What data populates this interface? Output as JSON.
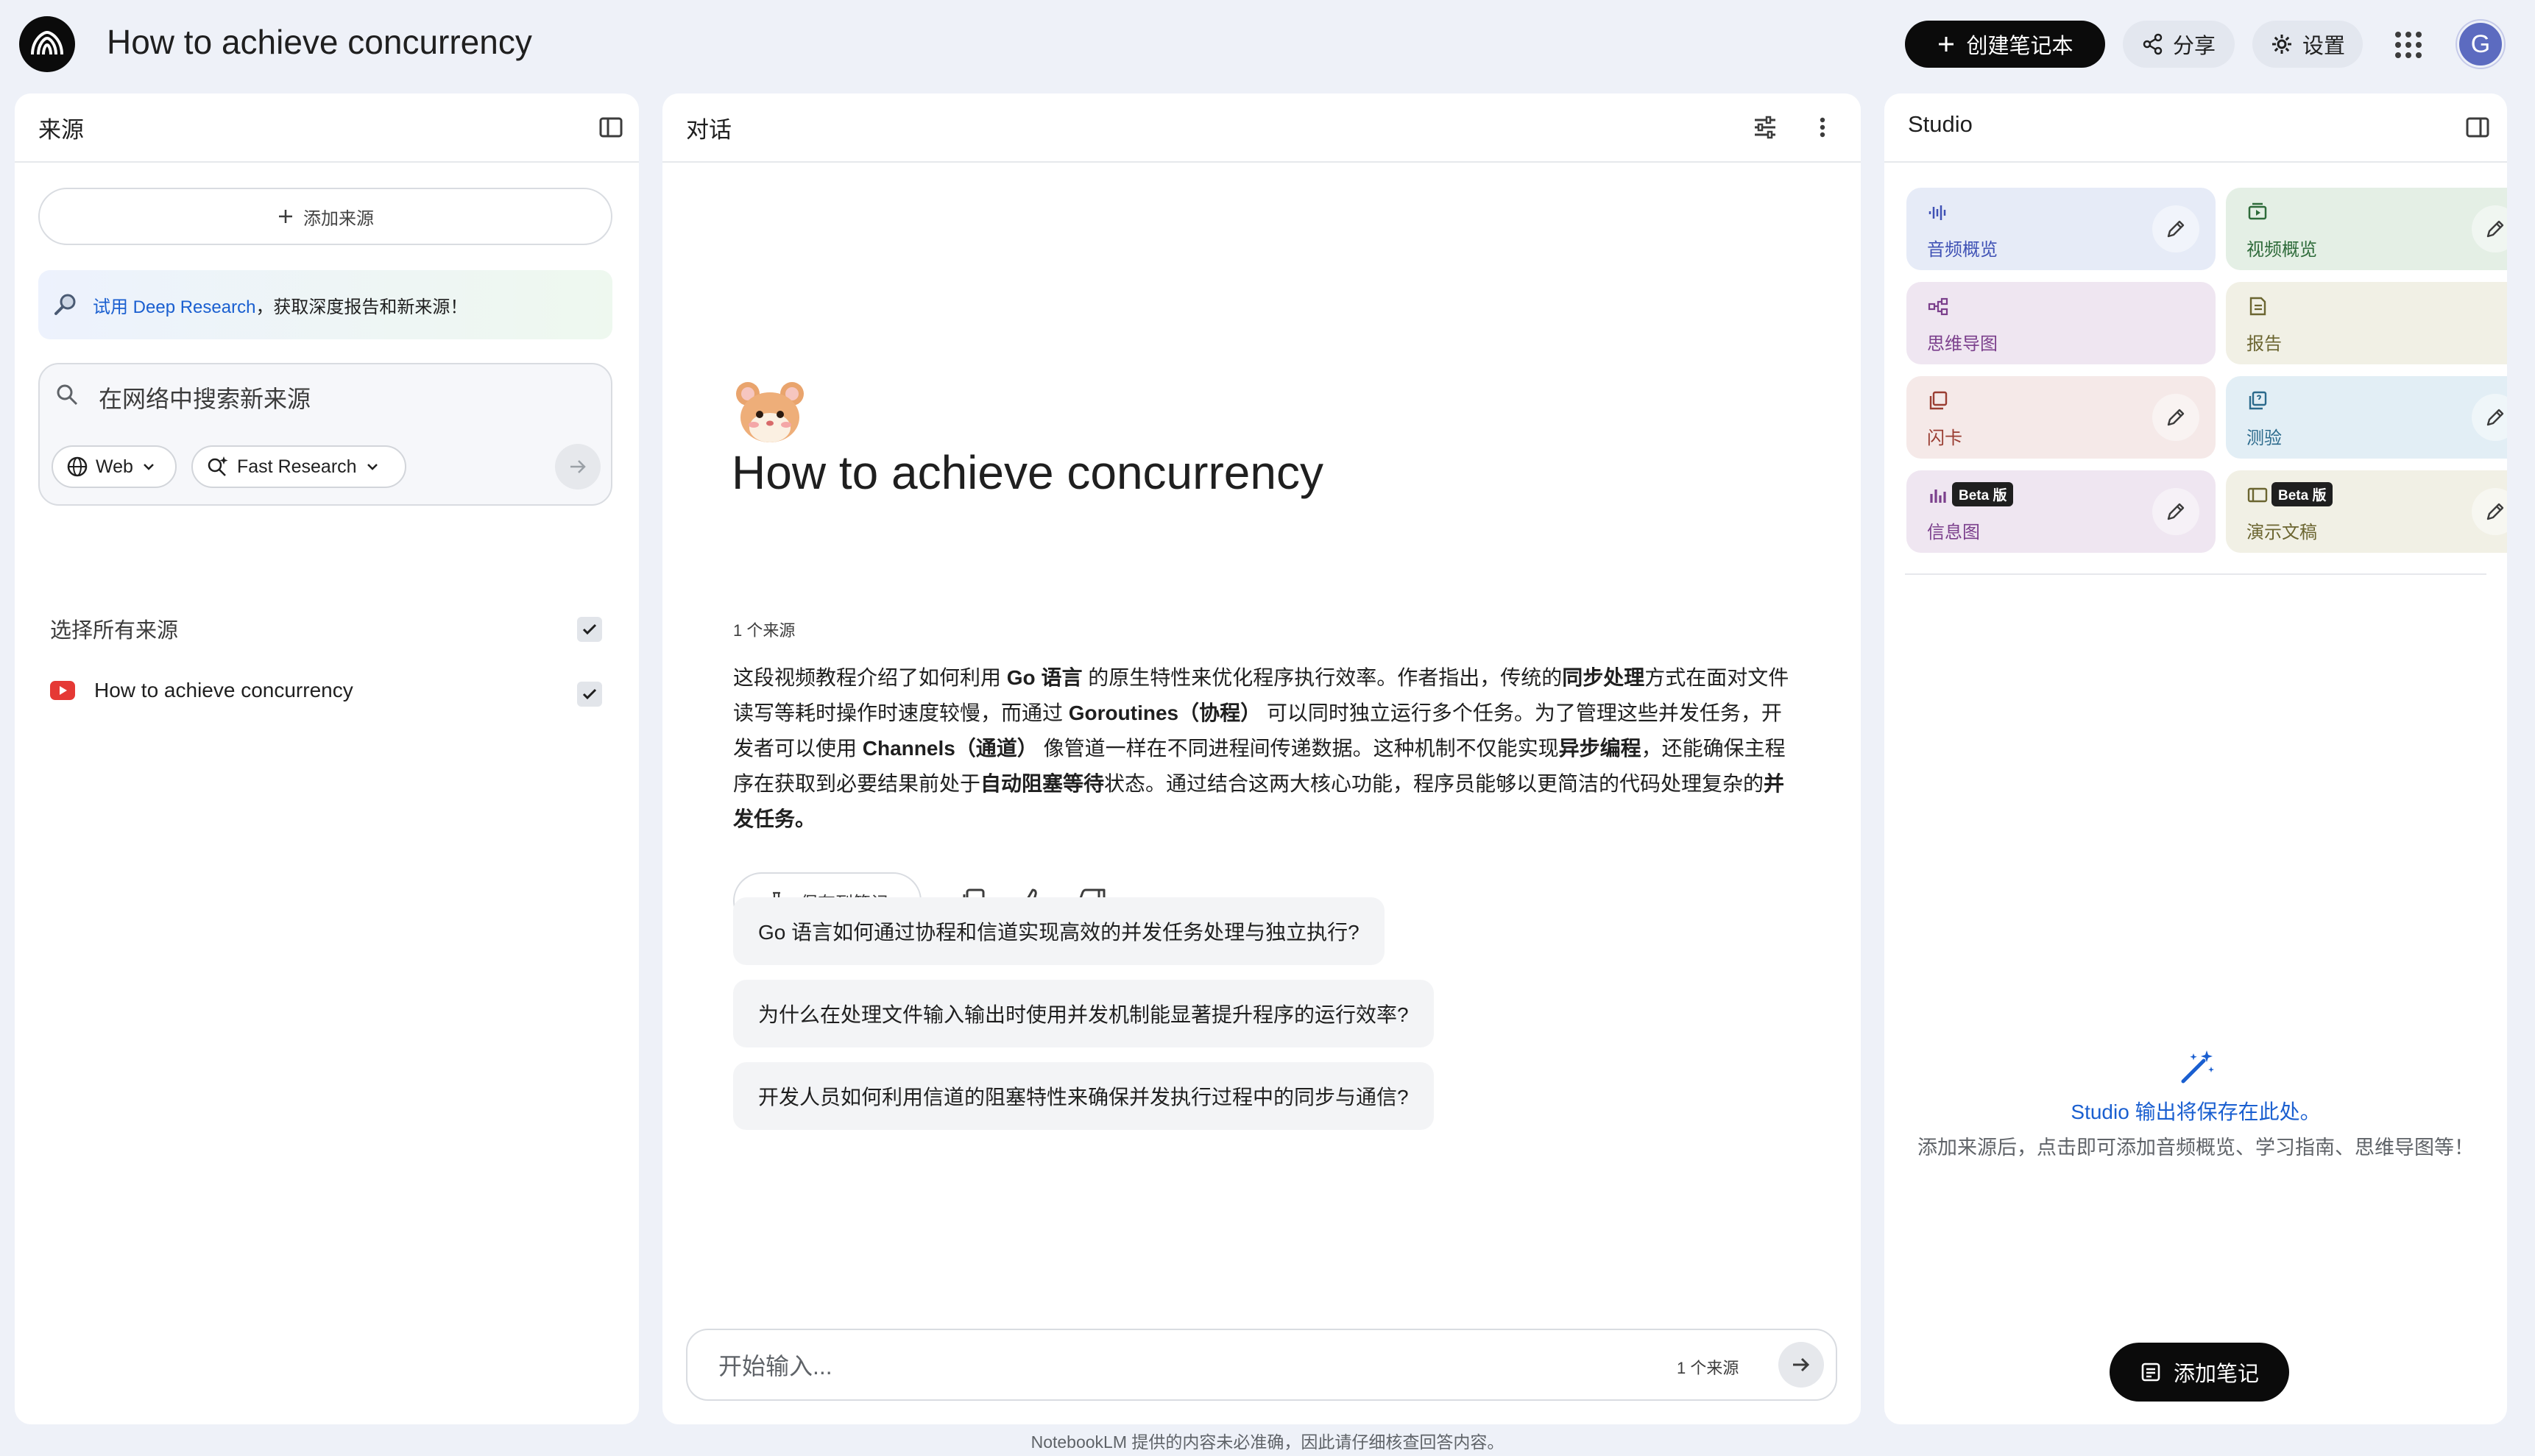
{
  "app": {
    "title": "How to achieve concurrency"
  },
  "topbar": {
    "create_label": "创建笔记本",
    "share_label": "分享",
    "settings_label": "设置",
    "avatar_initial": "G"
  },
  "sources": {
    "title": "来源",
    "add_label": "添加来源",
    "deep_research": {
      "link": "试用 Deep Research",
      "text": "，获取深度报告和新来源！"
    },
    "search_placeholder": "在网络中搜索新来源",
    "web_chip": "Web",
    "research_chip": "Fast Research",
    "select_all": "选择所有来源",
    "items": [
      {
        "label": "How to achieve concurrency",
        "checked": true
      }
    ]
  },
  "chat": {
    "title": "对话",
    "emoji": "🐹",
    "heading": "How to achieve concurrency",
    "source_count": "1 个来源",
    "summary": [
      {
        "text": "这段视频教程介绍了如何利用 ",
        "b": false
      },
      {
        "text": "Go 语言",
        "b": true
      },
      {
        "text": " 的原生特性来优化程序执行效率。作者指出，传统的",
        "b": false
      },
      {
        "text": "同步处理",
        "b": true
      },
      {
        "text": "方式在面对文件读写等耗时操作时速度较慢，而通过 ",
        "b": false
      },
      {
        "text": "Goroutines（协程）",
        "b": true
      },
      {
        "text": " 可以同时独立运行多个任务。为了管理这些并发任务，开发者可以使用 ",
        "b": false
      },
      {
        "text": "Channels（通道）",
        "b": true
      },
      {
        "text": " 像管道一样在不同进程间传递数据。这种机制不仅能实现",
        "b": false
      },
      {
        "text": "异步编程",
        "b": true
      },
      {
        "text": "，还能确保主程序在获取到必要结果前处于",
        "b": false
      },
      {
        "text": "自动阻塞等待",
        "b": true
      },
      {
        "text": "状态。通过结合这两大核心功能，程序员能够以更简洁的代码处理复杂的",
        "b": false
      },
      {
        "text": "并发任务。",
        "b": true
      }
    ],
    "save_note_label": "保存到笔记",
    "suggestions": [
      "Go 语言如何通过协程和信道实现高效的并发任务处理与独立执行?",
      "为什么在处理文件输入输出时使用并发机制能显著提升程序的运行效率?",
      "开发人员如何利用信道的阻塞特性来确保并发执行过程中的同步与通信?"
    ],
    "input_placeholder": "开始输入...",
    "input_source_count": "1 个来源"
  },
  "studio": {
    "title": "Studio",
    "tiles": [
      {
        "label": "音频概览",
        "icon": "audio-overview-icon",
        "bg": "#e6ebf7",
        "fg": "#3f51b5",
        "beta": false,
        "edit": true
      },
      {
        "label": "视频概览",
        "icon": "video-overview-icon",
        "bg": "#e4efe5",
        "fg": "#2e6b3a",
        "beta": false,
        "edit": true
      },
      {
        "label": "思维导图",
        "icon": "mind-map-icon",
        "bg": "#efe6f1",
        "fg": "#7b3f8c",
        "beta": false,
        "edit": false
      },
      {
        "label": "报告",
        "icon": "report-icon",
        "bg": "#f1f0e5",
        "fg": "#6b6530",
        "beta": false,
        "edit": false
      },
      {
        "label": "闪卡",
        "icon": "flashcards-icon",
        "bg": "#f5e9e8",
        "fg": "#9a3d32",
        "beta": false,
        "edit": true
      },
      {
        "label": "测验",
        "icon": "quiz-icon",
        "bg": "#e2eef5",
        "fg": "#2b6a8c",
        "beta": false,
        "edit": true
      },
      {
        "label": "信息图",
        "icon": "infographic-icon",
        "bg": "#efe6f1",
        "fg": "#7b3f8c",
        "beta": true,
        "edit": true
      },
      {
        "label": "演示文稿",
        "icon": "slides-icon",
        "bg": "#f1f0e5",
        "fg": "#6b6530",
        "beta": true,
        "edit": true
      }
    ],
    "beta_label": "Beta 版",
    "empty_title": "Studio 输出将保存在此处。",
    "empty_desc": "添加来源后，点击即可添加音频概览、学习指南、思维导图等！",
    "add_note_label": "添加笔记"
  },
  "footer": "NotebookLM 提供的内容未必准确，因此请仔细核查回答内容。",
  "colors": {
    "accent": "#1a5fd0",
    "dark": "#0b0b0b",
    "background": "#eef1f8"
  }
}
